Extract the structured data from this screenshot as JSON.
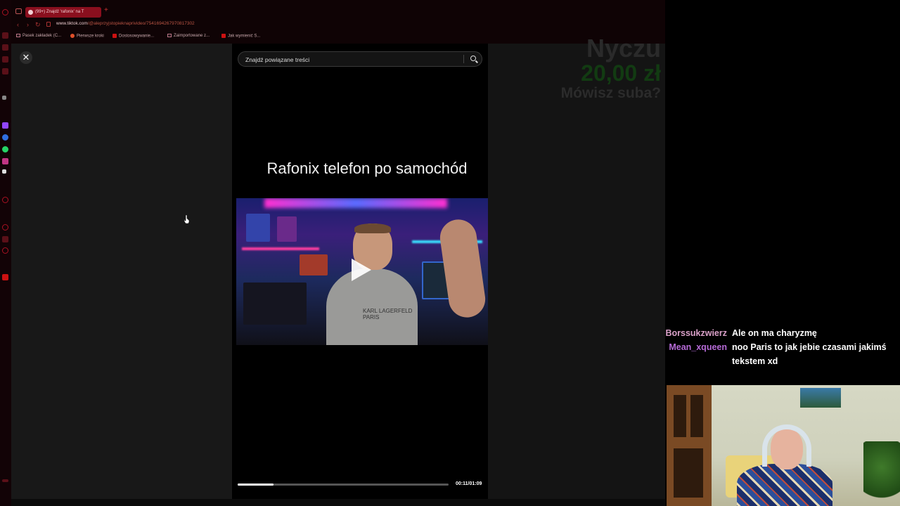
{
  "browser": {
    "tab_title": "(99+) Znajdź 'rafonix' na T",
    "new_tab": "+",
    "url_host": "www.tiktok.com",
    "url_path": "/@aleprzyjstopieknaprivideo/7541694267970817302",
    "bookmarks": [
      "Pasek zakładek (C...",
      "Pierwsze kroki",
      "Dostosowywanie...",
      "Zaimportowane z...",
      "Jak wymienić S..."
    ]
  },
  "tiktok": {
    "close_label": "✕",
    "search_placeholder": "Znajdź powiązane treści",
    "video_caption": "Rafonix telefon po samochód",
    "shirt_print": "KARL LAGERFELD PARIS",
    "progress": 0.17,
    "timecode": "00:11/01:09"
  },
  "donation": {
    "name": "Nyczu",
    "amount": "20,00 zł",
    "message": "Mówisz suba?"
  },
  "chat": [
    {
      "user": "Borssukzwierz",
      "color": "#d9a0c8",
      "text": "Ale on ma charyzmę"
    },
    {
      "user": "Mean_xqueen",
      "color": "#b56ad6",
      "text": "noo Paris to jak jebie czasami jakimś tekstem xd"
    }
  ],
  "colors": {
    "accent": "#8a0f1e",
    "page_bg": "#181818",
    "donation_amount": "#123b12"
  }
}
